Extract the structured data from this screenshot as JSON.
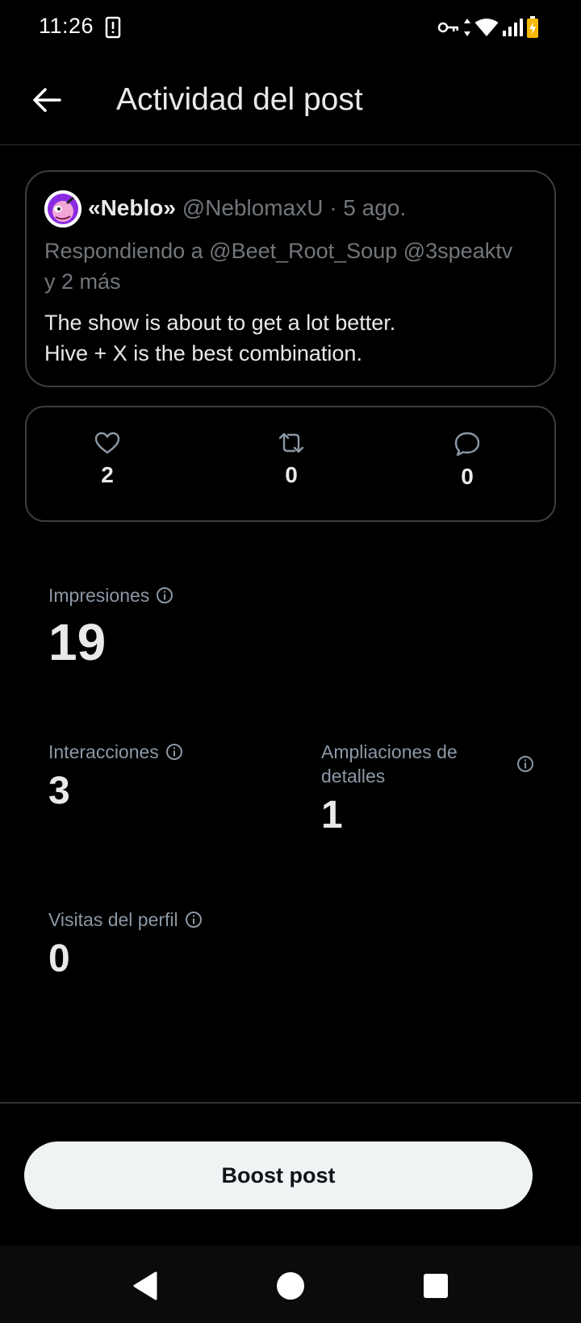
{
  "status_bar": {
    "time": "11:26",
    "icons": [
      "alert-icon",
      "key-icon",
      "data-arrows-icon",
      "wifi-icon",
      "signal-icon",
      "battery-icon"
    ]
  },
  "app_bar": {
    "title": "Actividad del post"
  },
  "post": {
    "author_name": "«Neblo»",
    "meta": "@NeblomaxU · 5 ago.",
    "reply_to": "Respondiendo a @Beet_Root_Soup @3speaktv y 2 más",
    "text_line1": "The show is about to get a lot better.",
    "text_line2": "Hive + X is the best combination."
  },
  "engagement": {
    "likes": "2",
    "reposts": "0",
    "replies": "0"
  },
  "metrics": {
    "impressions_label": "Impresiones",
    "impressions_value": "19",
    "interactions_label": "Interacciones",
    "interactions_value": "3",
    "detail_expands_label": "Ampliaciones de detalles",
    "detail_expands_value": "1",
    "profile_visits_label": "Visitas del perfil",
    "profile_visits_value": "0"
  },
  "actions": {
    "boost_label": "Boost post"
  },
  "colors": {
    "background": "#000000",
    "text": "#e7e9ea",
    "muted": "#71767b",
    "border": "#3a3e42",
    "button_bg": "#eff3f4"
  }
}
